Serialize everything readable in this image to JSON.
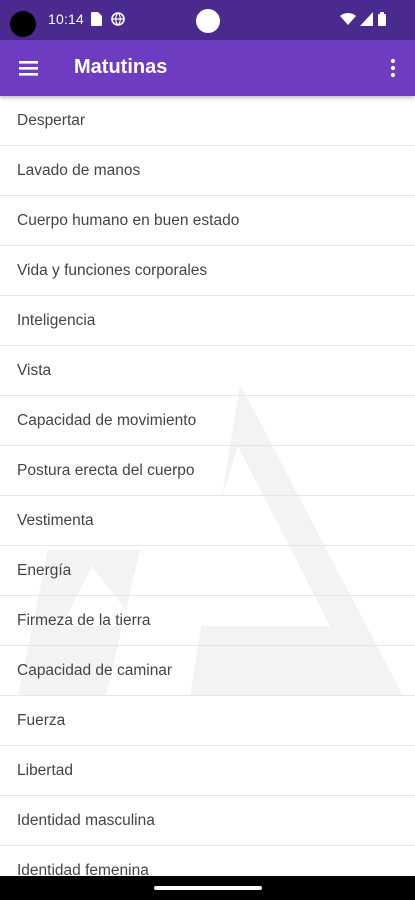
{
  "status_bar": {
    "time": "10:14",
    "background": "#4b2a8f"
  },
  "app_bar": {
    "title": "Matutinas",
    "background": "#6e3cc0"
  },
  "icons": {
    "menu": "hamburger-menu-icon",
    "more": "more-vert-icon",
    "status_left": [
      "sim-card-icon",
      "vpn-globe-icon"
    ],
    "status_right": [
      "wifi-icon",
      "cell-signal-icon",
      "battery-icon"
    ]
  },
  "list": {
    "items": [
      "Despertar",
      "Lavado de manos",
      "Cuerpo humano en buen estado",
      "Vida y funciones corporales",
      "Inteligencia",
      "Vista",
      "Capacidad de movimiento",
      "Postura erecta del cuerpo",
      "Vestimenta",
      "Energía",
      "Firmeza de la tierra",
      "Capacidad de caminar",
      "Fuerza",
      "Libertad",
      "Identidad masculina",
      "Identidad femenina"
    ]
  }
}
